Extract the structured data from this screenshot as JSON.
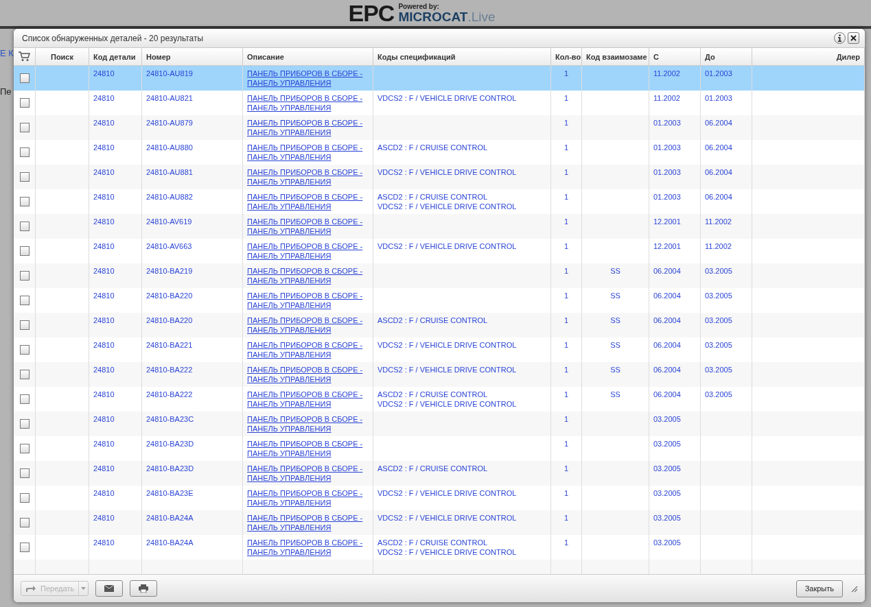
{
  "logo": {
    "main": "EPC",
    "powered": "Powered by:",
    "brand": "MICROCAT",
    "brand_suffix": ".Live"
  },
  "background_fragments": [
    "Е К",
    "Пе"
  ],
  "dialog": {
    "title": "Список обнаруженных деталей - 20 результаты"
  },
  "table": {
    "columns": [
      "Поиск",
      "Код детали",
      "Номер",
      "Описание",
      "Коды спецификаций",
      "Кол-во",
      "Код взаимозаме",
      "С",
      "До",
      "Дилер"
    ],
    "rows": [
      {
        "selected": true,
        "checked": false,
        "code": "24810",
        "number": "24810-AU819",
        "description": "ПАНЕЛЬ ПРИБОРОВ В СБОРЕ - ПАНЕЛЬ УПРАВЛЕНИЯ",
        "specs": [],
        "qty": "1",
        "interchange": "",
        "from": "11.2002",
        "to": "01.2003"
      },
      {
        "selected": false,
        "checked": false,
        "code": "24810",
        "number": "24810-AU821",
        "description": "ПАНЕЛЬ ПРИБОРОВ В СБОРЕ - ПАНЕЛЬ УПРАВЛЕНИЯ",
        "specs": [
          "VDCS2 : F / VEHICLE DRIVE CONTROL"
        ],
        "qty": "1",
        "interchange": "",
        "from": "11.2002",
        "to": "01.2003"
      },
      {
        "selected": false,
        "checked": false,
        "code": "24810",
        "number": "24810-AU879",
        "description": "ПАНЕЛЬ ПРИБОРОВ В СБОРЕ - ПАНЕЛЬ УПРАВЛЕНИЯ",
        "specs": [],
        "qty": "1",
        "interchange": "",
        "from": "01.2003",
        "to": "06.2004"
      },
      {
        "selected": false,
        "checked": false,
        "code": "24810",
        "number": "24810-AU880",
        "description": "ПАНЕЛЬ ПРИБОРОВ В СБОРЕ - ПАНЕЛЬ УПРАВЛЕНИЯ",
        "specs": [
          "ASCD2 : F / CRUISE CONTROL"
        ],
        "qty": "1",
        "interchange": "",
        "from": "01.2003",
        "to": "06.2004"
      },
      {
        "selected": false,
        "checked": false,
        "code": "24810",
        "number": "24810-AU881",
        "description": "ПАНЕЛЬ ПРИБОРОВ В СБОРЕ - ПАНЕЛЬ УПРАВЛЕНИЯ",
        "specs": [
          "VDCS2 : F / VEHICLE DRIVE CONTROL"
        ],
        "qty": "1",
        "interchange": "",
        "from": "01.2003",
        "to": "06.2004"
      },
      {
        "selected": false,
        "checked": false,
        "code": "24810",
        "number": "24810-AU882",
        "description": "ПАНЕЛЬ ПРИБОРОВ В СБОРЕ - ПАНЕЛЬ УПРАВЛЕНИЯ",
        "specs": [
          "ASCD2 : F / CRUISE CONTROL",
          "VDCS2 : F / VEHICLE DRIVE CONTROL"
        ],
        "qty": "1",
        "interchange": "",
        "from": "01.2003",
        "to": "06.2004"
      },
      {
        "selected": false,
        "checked": false,
        "code": "24810",
        "number": "24810-AV619",
        "description": "ПАНЕЛЬ ПРИБОРОВ В СБОРЕ - ПАНЕЛЬ УПРАВЛЕНИЯ",
        "specs": [],
        "qty": "1",
        "interchange": "",
        "from": "12.2001",
        "to": "11.2002"
      },
      {
        "selected": false,
        "checked": false,
        "code": "24810",
        "number": "24810-AV663",
        "description": "ПАНЕЛЬ ПРИБОРОВ В СБОРЕ - ПАНЕЛЬ УПРАВЛЕНИЯ",
        "specs": [
          "VDCS2 : F / VEHICLE DRIVE CONTROL"
        ],
        "qty": "1",
        "interchange": "",
        "from": "12.2001",
        "to": "11.2002"
      },
      {
        "selected": false,
        "checked": false,
        "code": "24810",
        "number": "24810-BA219",
        "description": "ПАНЕЛЬ ПРИБОРОВ В СБОРЕ - ПАНЕЛЬ УПРАВЛЕНИЯ",
        "specs": [],
        "qty": "1",
        "interchange": "SS",
        "from": "06.2004",
        "to": "03.2005"
      },
      {
        "selected": false,
        "checked": false,
        "code": "24810",
        "number": "24810-BA220",
        "description": "ПАНЕЛЬ ПРИБОРОВ В СБОРЕ - ПАНЕЛЬ УПРАВЛЕНИЯ",
        "specs": [],
        "qty": "1",
        "interchange": "SS",
        "from": "06.2004",
        "to": "03.2005"
      },
      {
        "selected": false,
        "checked": false,
        "code": "24810",
        "number": "24810-BA220",
        "description": "ПАНЕЛЬ ПРИБОРОВ В СБОРЕ - ПАНЕЛЬ УПРАВЛЕНИЯ",
        "specs": [
          "ASCD2 : F / CRUISE CONTROL"
        ],
        "qty": "1",
        "interchange": "SS",
        "from": "06.2004",
        "to": "03.2005"
      },
      {
        "selected": false,
        "checked": false,
        "code": "24810",
        "number": "24810-BA221",
        "description": "ПАНЕЛЬ ПРИБОРОВ В СБОРЕ - ПАНЕЛЬ УПРАВЛЕНИЯ",
        "specs": [
          "VDCS2 : F / VEHICLE DRIVE CONTROL"
        ],
        "qty": "1",
        "interchange": "SS",
        "from": "06.2004",
        "to": "03.2005"
      },
      {
        "selected": false,
        "checked": false,
        "code": "24810",
        "number": "24810-BA222",
        "description": "ПАНЕЛЬ ПРИБОРОВ В СБОРЕ - ПАНЕЛЬ УПРАВЛЕНИЯ",
        "specs": [
          "VDCS2 : F / VEHICLE DRIVE CONTROL"
        ],
        "qty": "1",
        "interchange": "SS",
        "from": "06.2004",
        "to": "03.2005"
      },
      {
        "selected": false,
        "checked": false,
        "code": "24810",
        "number": "24810-BA222",
        "description": "ПАНЕЛЬ ПРИБОРОВ В СБОРЕ - ПАНЕЛЬ УПРАВЛЕНИЯ",
        "specs": [
          "ASCD2 : F / CRUISE CONTROL",
          "VDCS2 : F / VEHICLE DRIVE CONTROL"
        ],
        "qty": "1",
        "interchange": "SS",
        "from": "06.2004",
        "to": "03.2005"
      },
      {
        "selected": false,
        "checked": false,
        "code": "24810",
        "number": "24810-BA23C",
        "description": "ПАНЕЛЬ ПРИБОРОВ В СБОРЕ - ПАНЕЛЬ УПРАВЛЕНИЯ",
        "specs": [],
        "qty": "1",
        "interchange": "",
        "from": "03.2005",
        "to": ""
      },
      {
        "selected": false,
        "checked": false,
        "code": "24810",
        "number": "24810-BA23D",
        "description": "ПАНЕЛЬ ПРИБОРОВ В СБОРЕ - ПАНЕЛЬ УПРАВЛЕНИЯ",
        "specs": [],
        "qty": "1",
        "interchange": "",
        "from": "03.2005",
        "to": ""
      },
      {
        "selected": false,
        "checked": false,
        "code": "24810",
        "number": "24810-BA23D",
        "description": "ПАНЕЛЬ ПРИБОРОВ В СБОРЕ - ПАНЕЛЬ УПРАВЛЕНИЯ",
        "specs": [
          "ASCD2 : F / CRUISE CONTROL"
        ],
        "qty": "1",
        "interchange": "",
        "from": "03.2005",
        "to": ""
      },
      {
        "selected": false,
        "checked": false,
        "code": "24810",
        "number": "24810-BA23E",
        "description": "ПАНЕЛЬ ПРИБОРОВ В СБОРЕ - ПАНЕЛЬ УПРАВЛЕНИЯ",
        "specs": [
          "VDCS2 : F / VEHICLE DRIVE CONTROL"
        ],
        "qty": "1",
        "interchange": "",
        "from": "03.2005",
        "to": ""
      },
      {
        "selected": false,
        "checked": false,
        "code": "24810",
        "number": "24810-BA24A",
        "description": "ПАНЕЛЬ ПРИБОРОВ В СБОРЕ - ПАНЕЛЬ УПРАВЛЕНИЯ",
        "specs": [
          "VDCS2 : F / VEHICLE DRIVE CONTROL"
        ],
        "qty": "1",
        "interchange": "",
        "from": "03.2005",
        "to": ""
      },
      {
        "selected": false,
        "checked": false,
        "code": "24810",
        "number": "24810-BA24A",
        "description": "ПАНЕЛЬ ПРИБОРОВ В СБОРЕ - ПАНЕЛЬ УПРАВЛЕНИЯ",
        "specs": [
          "ASCD2 : F / CRUISE CONTROL",
          "VDCS2 : F / VEHICLE DRIVE CONTROL"
        ],
        "qty": "1",
        "interchange": "",
        "from": "03.2005",
        "to": ""
      }
    ]
  },
  "footer": {
    "transfer": {
      "label": "Передать",
      "disabled": true
    },
    "close": "Закрыть"
  }
}
